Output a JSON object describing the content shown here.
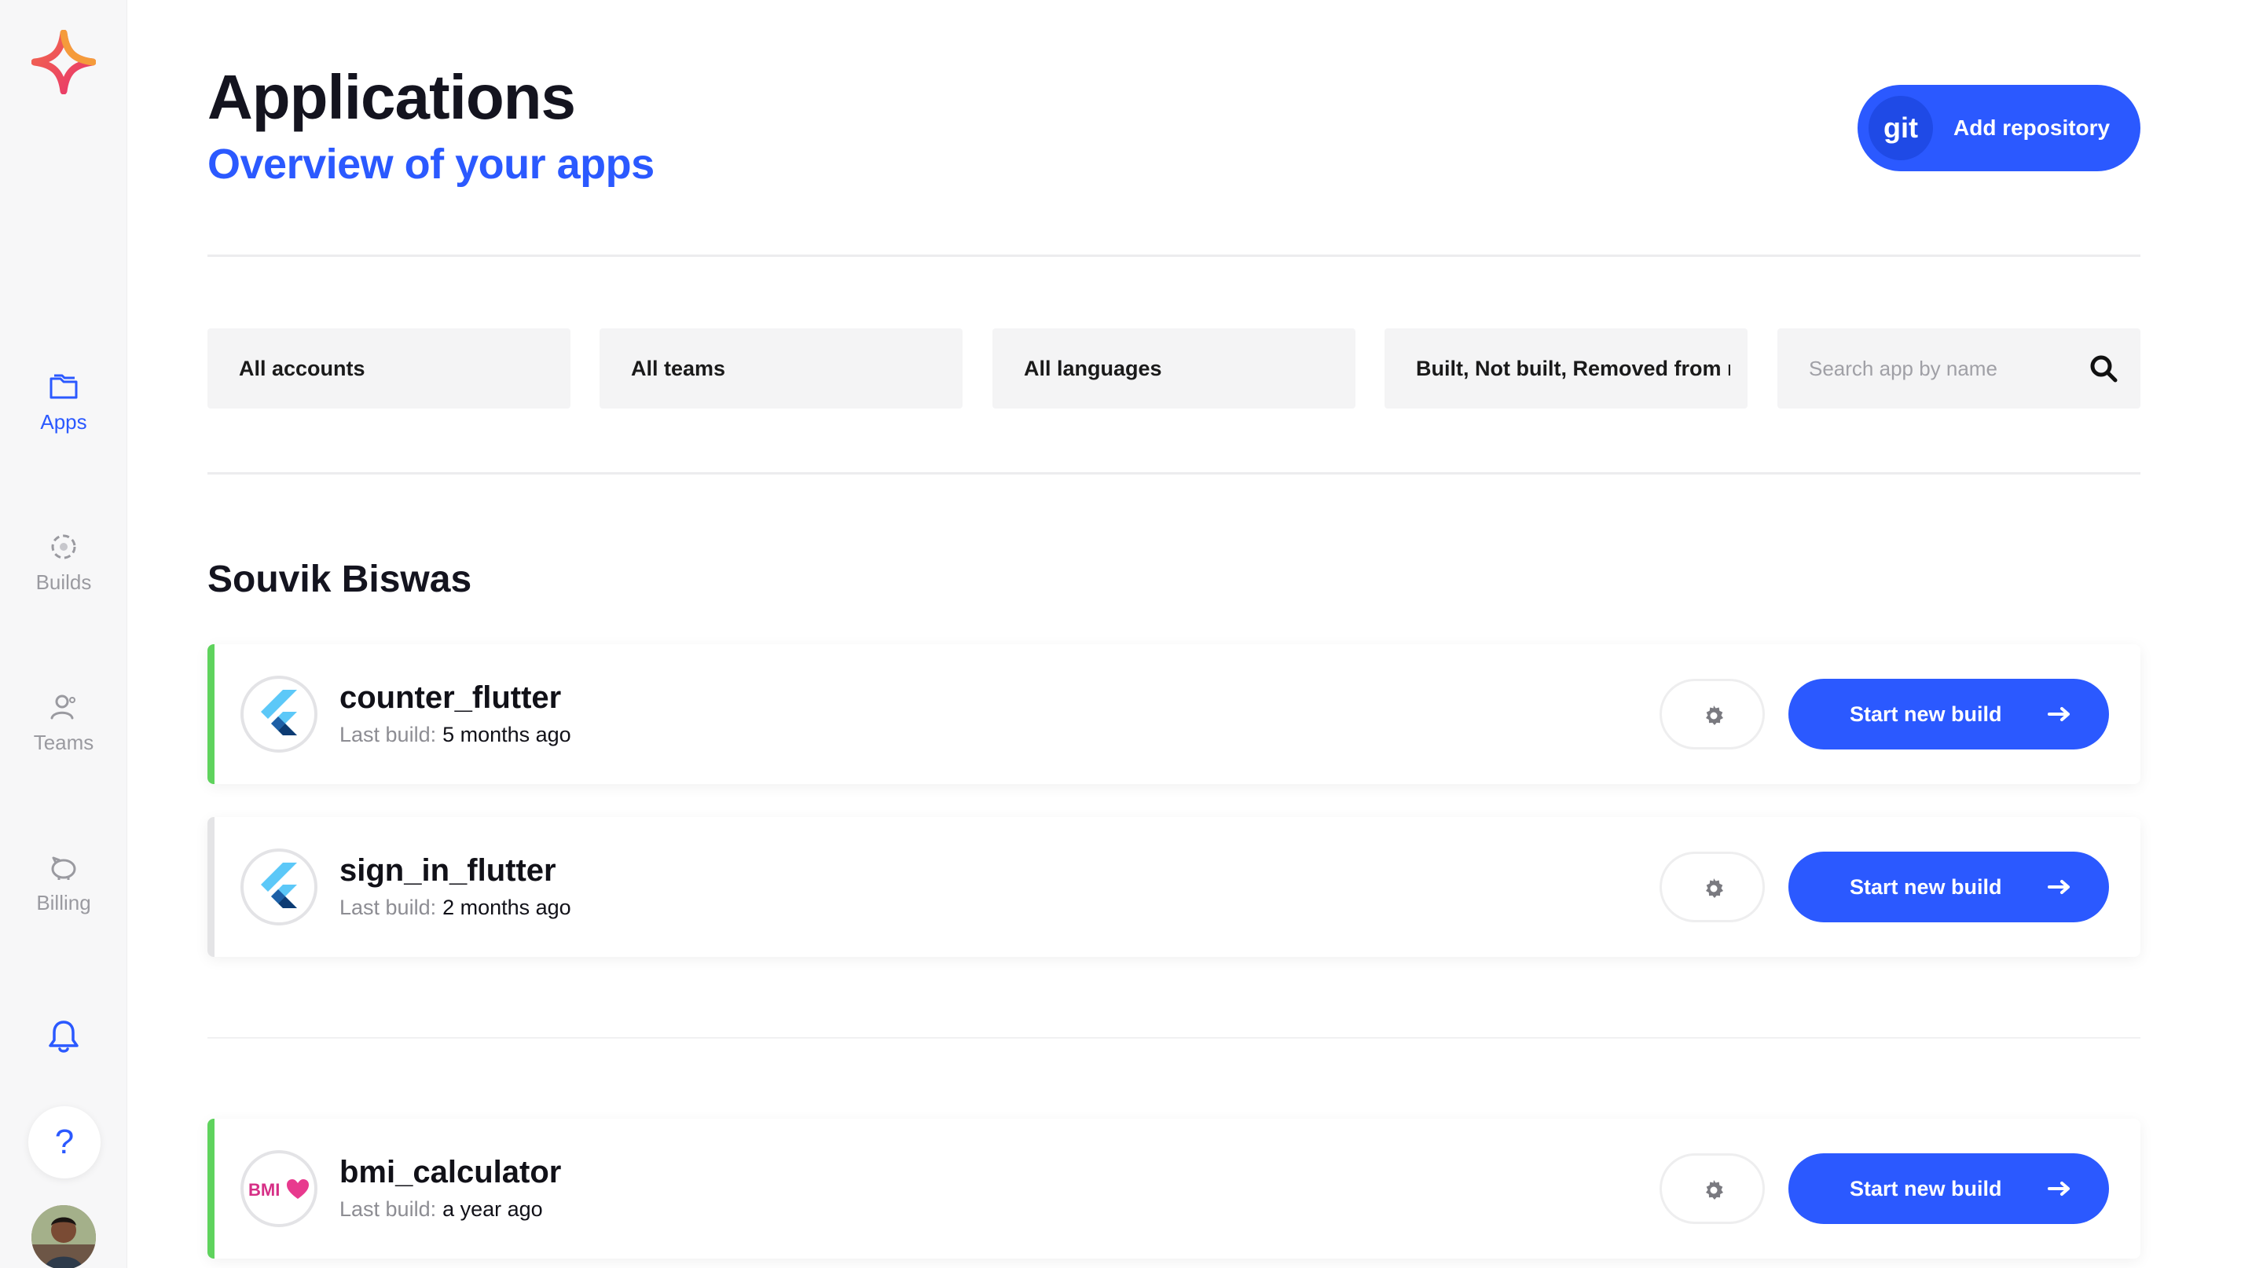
{
  "sidebar": {
    "logo_icon": "codemagic-star-logo-icon",
    "items": [
      {
        "label": "Apps",
        "icon": "folder-icon",
        "active": true
      },
      {
        "label": "Builds",
        "icon": "builds-icon",
        "active": false
      },
      {
        "label": "Teams",
        "icon": "user-icon",
        "active": false
      },
      {
        "label": "Billing",
        "icon": "piggy-bank-icon",
        "active": false
      }
    ],
    "notifications_icon": "bell-icon",
    "help_label": "?",
    "avatar_icon": "user-avatar"
  },
  "header": {
    "title": "Applications",
    "subtitle": "Overview of your apps",
    "add_repository": {
      "icon_text": "git",
      "label": "Add repository"
    }
  },
  "filters": {
    "accounts": "All accounts",
    "teams": "All teams",
    "languages": "All languages",
    "build_status": "Built, Not built, Removed from r",
    "search_placeholder": "Search app by name",
    "search_icon": "search-icon"
  },
  "owner": "Souvik Biswas",
  "apps": [
    {
      "name": "counter_flutter",
      "last_build_label": "Last build:",
      "last_build": "5 months ago",
      "logo": "flutter-logo",
      "stripe_color": "#5fd35d",
      "build_label": "Start new build"
    },
    {
      "name": "sign_in_flutter",
      "last_build_label": "Last build:",
      "last_build": "2 months ago",
      "logo": "flutter-logo",
      "stripe_color": "#e4e4e6",
      "build_label": "Start new build"
    },
    {
      "name": "bmi_calculator",
      "last_build_label": "Last build:",
      "last_build": "a year ago",
      "logo": "bmi-heart-logo",
      "logo_text": "BMI",
      "stripe_color": "#5fd35d",
      "build_label": "Start new build"
    }
  ],
  "colors": {
    "accent": "#2b59ff",
    "success": "#5fd35d",
    "sidebar_bg": "#f7f7f8",
    "filter_bg": "#f4f4f5"
  }
}
